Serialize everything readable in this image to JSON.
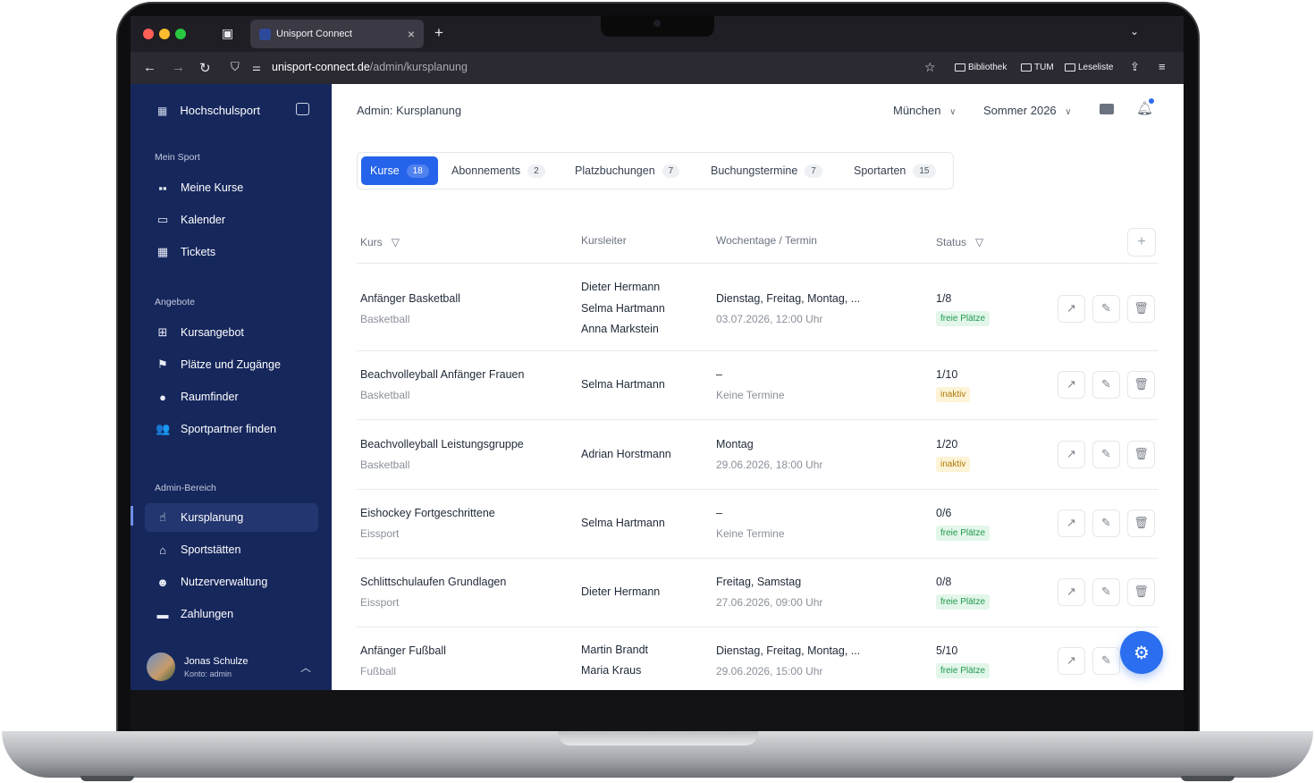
{
  "browser": {
    "tab_title": "Unisport Connect",
    "url_domain": "unisport-connect.de",
    "url_path": "/admin/kursplanung",
    "bookmarks": [
      "Bibliothek",
      "TUM",
      "Leseliste"
    ],
    "colors": {
      "close": "#ff5f57",
      "minimize": "#febc2e",
      "maximize": "#28c840"
    }
  },
  "sidebar": {
    "brand": "Hochschulsport",
    "sections": [
      {
        "label": "Mein Sport",
        "items": [
          {
            "label": "Meine Kurse",
            "icon": "id-card-icon"
          },
          {
            "label": "Kalender",
            "icon": "calendar-icon"
          },
          {
            "label": "Tickets",
            "icon": "qr-code-icon"
          }
        ]
      },
      {
        "label": "Angebote",
        "items": [
          {
            "label": "Kursangebot",
            "icon": "grid-plus-icon"
          },
          {
            "label": "Plätze und Zugänge",
            "icon": "flag-icon"
          },
          {
            "label": "Raumfinder",
            "icon": "map-pin-icon"
          },
          {
            "label": "Sportpartner finden",
            "icon": "users-icon"
          }
        ]
      },
      {
        "label": "Admin-Bereich",
        "items": [
          {
            "label": "Kursplanung",
            "icon": "pointer-icon",
            "active": true
          },
          {
            "label": "Sportstätten",
            "icon": "building-icon"
          },
          {
            "label": "Nutzerverwaltung",
            "icon": "users-gear-icon"
          },
          {
            "label": "Zahlungen",
            "icon": "credit-card-icon"
          }
        ]
      }
    ],
    "user": {
      "name": "Jonas Schulze",
      "role": "Konto: admin"
    }
  },
  "header": {
    "title": "Admin: Kursplanung",
    "location": "München",
    "semester": "Sommer 2026"
  },
  "tabs": [
    {
      "label": "Kurse",
      "count": "18",
      "active": true
    },
    {
      "label": "Abonnements",
      "count": "2"
    },
    {
      "label": "Platzbuchungen",
      "count": "7"
    },
    {
      "label": "Buchungstermine",
      "count": "7"
    },
    {
      "label": "Sportarten",
      "count": "15"
    }
  ],
  "table": {
    "columns": [
      "Kurs",
      "Kursleiter",
      "Wochentage / Termin",
      "Status"
    ],
    "rows": [
      {
        "name": "Anfänger Basketball",
        "sport": "Basketball",
        "leaders": [
          "Dieter Hermann",
          "Selma Hartmann",
          "Anna Markstein"
        ],
        "days": "Dienstag, Freitag, Montag, ...",
        "date": "03.07.2026, 12:00 Uhr",
        "capacity": "1/8",
        "status": "freie Plätze",
        "status_type": "free"
      },
      {
        "name": "Beachvolleyball Anfänger Frauen",
        "sport": "Basketball",
        "leaders": [
          "Selma Hartmann"
        ],
        "days": "–",
        "date": "Keine Termine",
        "capacity": "1/10",
        "status": "inaktiv",
        "status_type": "off"
      },
      {
        "name": "Beachvolleyball Leistungsgruppe",
        "sport": "Basketball",
        "leaders": [
          "Adrian Horstmann"
        ],
        "days": "Montag",
        "date": "29.06.2026, 18:00 Uhr",
        "capacity": "1/20",
        "status": "inaktiv",
        "status_type": "off"
      },
      {
        "name": "Eishockey Fortgeschrittene",
        "sport": "Eissport",
        "leaders": [
          "Selma Hartmann"
        ],
        "days": "–",
        "date": "Keine Termine",
        "capacity": "0/6",
        "status": "freie Plätze",
        "status_type": "free"
      },
      {
        "name": "Schlittschulaufen Grundlagen",
        "sport": "Eissport",
        "leaders": [
          "Dieter Hermann"
        ],
        "days": "Freitag, Samstag",
        "date": "27.06.2026, 09:00 Uhr",
        "capacity": "0/8",
        "status": "freie Plätze",
        "status_type": "free"
      },
      {
        "name": "Anfänger Fußball",
        "sport": "Fußball",
        "leaders": [
          "Martin Brandt",
          "Maria Kraus"
        ],
        "days": "Dienstag, Freitag, Montag, ...",
        "date": "29.06.2026, 15:00 Uhr",
        "capacity": "5/10",
        "status": "freie Plätze",
        "status_type": "free"
      }
    ]
  }
}
